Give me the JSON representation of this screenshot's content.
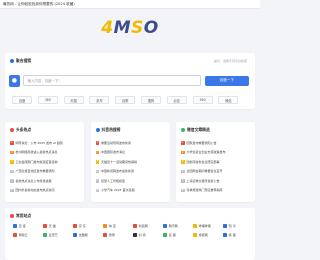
{
  "topbar": {
    "title": "最热网 - 让你轻松找到你想要的 (2024 收藏)"
  },
  "logo": {
    "part1": "4",
    "part2": "M",
    "part3": "S",
    "part4": "O"
  },
  "search": {
    "heading": "聚合搜索",
    "sub": "提示：选择不同平台搜索",
    "placeholder": "输入内容，百度一下！",
    "button": "百度一下",
    "tabs": [
      "百度",
      "360",
      "天猫",
      "京东",
      "谷歌",
      "搜狗",
      "必应",
      "360",
      "微信"
    ]
  },
  "columns": [
    {
      "heading": "头条热点",
      "items": [
        "网传消息：公布 2025 发布 AI 趋势",
        "杭州网络科技进入最新热点消息",
        "卫生健康部门发布新冠疫苗接种",
        "广西壮族自治区发布重要通知",
        "最新热点消息公布科技进展",
        "国内外最新动态发布热点新闻"
      ]
    },
    {
      "heading": "抖音热搜榜",
      "items": [
        "重要活动现场发布新闻",
        "中国国际发布消息",
        "天猫双十一活动期间热销榜",
        "中国新闻网发布最新新闻",
        "接受人工智能模型",
        "小米汽车 2025 首次亮相"
      ]
    },
    {
      "heading": "微信文章精选",
      "items": [
        "国家发布重要通知公告",
        "大学生就业创业支持政策发布",
        "国务院常务会议研究部署",
        "全国两会期间重要会议召开",
        "上海证券交易所最新公告",
        "冬季旅游热门景区推荐指南"
      ]
    }
  ],
  "favorites": {
    "heading": "常用站点",
    "items": [
      {
        "label": "百 度",
        "color": "#2f6fe4"
      },
      {
        "label": "天 猫",
        "color": "#e84c3d"
      },
      {
        "label": "京 东",
        "color": "#e84c3d"
      },
      {
        "label": "淘 宝",
        "color": "#f08a24"
      },
      {
        "label": "新浪网",
        "color": "#e84c3d"
      },
      {
        "label": "腾讯网",
        "color": "#2f6fe4"
      },
      {
        "label": "哔哩哔哩",
        "color": "#f5b800"
      },
      {
        "label": "知 乎",
        "color": "#2f6fe4"
      },
      {
        "label": "网易云",
        "color": "#e84c3d"
      },
      {
        "label": "爱奇艺",
        "color": "#3cb371"
      },
      {
        "label": "优酷网",
        "color": "#2f6fe4"
      },
      {
        "label": "微博",
        "color": "#e84c3d"
      },
      {
        "label": "抖 音",
        "color": "#333333"
      },
      {
        "label": "豆 瓣",
        "color": "#3cb371"
      },
      {
        "label": "搜狐网",
        "color": "#f5b800"
      },
      {
        "label": "携 程",
        "color": "#2f6fe4"
      }
    ]
  }
}
